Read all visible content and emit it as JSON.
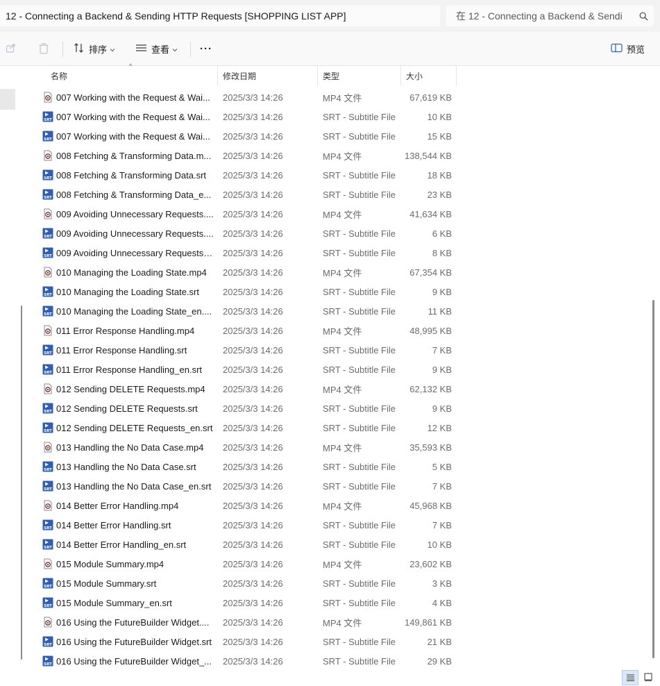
{
  "address": {
    "path": "12 - Connecting a Backend & Sending HTTP Requests  [SHOPPING LIST APP]"
  },
  "search": {
    "placeholder": "在 12 - Connecting a Backend & Sendi"
  },
  "toolbar": {
    "sort_label": "排序",
    "view_label": "查看",
    "more_label": "···",
    "preview_label": "预览"
  },
  "columns": {
    "name": "名称",
    "date": "修改日期",
    "type": "类型",
    "size": "大小"
  },
  "colors": {
    "mp4_icon_border": "#7a7a7a",
    "srt_icon_blue": "#2f5fb3",
    "secondary_text": "#6b6b6b"
  },
  "files": [
    {
      "name": "007 Working with the Request & Wai...",
      "date": "2025/3/3 14:26",
      "type": "MP4 文件",
      "size": "67,619 KB",
      "kind": "mp4"
    },
    {
      "name": "007 Working with the Request & Wai...",
      "date": "2025/3/3 14:26",
      "type": "SRT - Subtitle File",
      "size": "10 KB",
      "kind": "srt"
    },
    {
      "name": "007 Working with the Request & Wai...",
      "date": "2025/3/3 14:26",
      "type": "SRT - Subtitle File",
      "size": "15 KB",
      "kind": "srt"
    },
    {
      "name": "008 Fetching & Transforming Data.m...",
      "date": "2025/3/3 14:26",
      "type": "MP4 文件",
      "size": "138,544 KB",
      "kind": "mp4"
    },
    {
      "name": "008 Fetching & Transforming Data.srt",
      "date": "2025/3/3 14:26",
      "type": "SRT - Subtitle File",
      "size": "18 KB",
      "kind": "srt"
    },
    {
      "name": "008 Fetching & Transforming Data_e...",
      "date": "2025/3/3 14:26",
      "type": "SRT - Subtitle File",
      "size": "23 KB",
      "kind": "srt"
    },
    {
      "name": "009 Avoiding Unnecessary Requests....",
      "date": "2025/3/3 14:26",
      "type": "MP4 文件",
      "size": "41,634 KB",
      "kind": "mp4"
    },
    {
      "name": "009 Avoiding Unnecessary Requests....",
      "date": "2025/3/3 14:26",
      "type": "SRT - Subtitle File",
      "size": "6 KB",
      "kind": "srt"
    },
    {
      "name": "009 Avoiding Unnecessary Requests_...",
      "date": "2025/3/3 14:26",
      "type": "SRT - Subtitle File",
      "size": "8 KB",
      "kind": "srt"
    },
    {
      "name": "010 Managing the Loading State.mp4",
      "date": "2025/3/3 14:26",
      "type": "MP4 文件",
      "size": "67,354 KB",
      "kind": "mp4"
    },
    {
      "name": "010 Managing the Loading State.srt",
      "date": "2025/3/3 14:26",
      "type": "SRT - Subtitle File",
      "size": "9 KB",
      "kind": "srt"
    },
    {
      "name": "010 Managing the Loading State_en....",
      "date": "2025/3/3 14:26",
      "type": "SRT - Subtitle File",
      "size": "11 KB",
      "kind": "srt"
    },
    {
      "name": "011 Error Response Handling.mp4",
      "date": "2025/3/3 14:26",
      "type": "MP4 文件",
      "size": "48,995 KB",
      "kind": "mp4"
    },
    {
      "name": "011 Error Response Handling.srt",
      "date": "2025/3/3 14:26",
      "type": "SRT - Subtitle File",
      "size": "7 KB",
      "kind": "srt"
    },
    {
      "name": "011 Error Response Handling_en.srt",
      "date": "2025/3/3 14:26",
      "type": "SRT - Subtitle File",
      "size": "9 KB",
      "kind": "srt"
    },
    {
      "name": "012 Sending DELETE Requests.mp4",
      "date": "2025/3/3 14:26",
      "type": "MP4 文件",
      "size": "62,132 KB",
      "kind": "mp4"
    },
    {
      "name": "012 Sending DELETE Requests.srt",
      "date": "2025/3/3 14:26",
      "type": "SRT - Subtitle File",
      "size": "9 KB",
      "kind": "srt"
    },
    {
      "name": "012 Sending DELETE Requests_en.srt",
      "date": "2025/3/3 14:26",
      "type": "SRT - Subtitle File",
      "size": "12 KB",
      "kind": "srt"
    },
    {
      "name": "013 Handling the No Data Case.mp4",
      "date": "2025/3/3 14:26",
      "type": "MP4 文件",
      "size": "35,593 KB",
      "kind": "mp4"
    },
    {
      "name": "013 Handling the No Data Case.srt",
      "date": "2025/3/3 14:26",
      "type": "SRT - Subtitle File",
      "size": "5 KB",
      "kind": "srt"
    },
    {
      "name": "013 Handling the No Data Case_en.srt",
      "date": "2025/3/3 14:26",
      "type": "SRT - Subtitle File",
      "size": "7 KB",
      "kind": "srt"
    },
    {
      "name": "014 Better Error Handling.mp4",
      "date": "2025/3/3 14:26",
      "type": "MP4 文件",
      "size": "45,968 KB",
      "kind": "mp4"
    },
    {
      "name": "014 Better Error Handling.srt",
      "date": "2025/3/3 14:26",
      "type": "SRT - Subtitle File",
      "size": "7 KB",
      "kind": "srt"
    },
    {
      "name": "014 Better Error Handling_en.srt",
      "date": "2025/3/3 14:26",
      "type": "SRT - Subtitle File",
      "size": "10 KB",
      "kind": "srt"
    },
    {
      "name": "015 Module Summary.mp4",
      "date": "2025/3/3 14:26",
      "type": "MP4 文件",
      "size": "23,602 KB",
      "kind": "mp4"
    },
    {
      "name": "015 Module Summary.srt",
      "date": "2025/3/3 14:26",
      "type": "SRT - Subtitle File",
      "size": "3 KB",
      "kind": "srt"
    },
    {
      "name": "015 Module Summary_en.srt",
      "date": "2025/3/3 14:26",
      "type": "SRT - Subtitle File",
      "size": "4 KB",
      "kind": "srt"
    },
    {
      "name": "016 Using the FutureBuilder Widget....",
      "date": "2025/3/3 14:26",
      "type": "MP4 文件",
      "size": "149,861 KB",
      "kind": "mp4"
    },
    {
      "name": "016 Using the FutureBuilder Widget.srt",
      "date": "2025/3/3 14:26",
      "type": "SRT - Subtitle File",
      "size": "21 KB",
      "kind": "srt"
    },
    {
      "name": "016 Using the FutureBuilder Widget_...",
      "date": "2025/3/3 14:26",
      "type": "SRT - Subtitle File",
      "size": "29 KB",
      "kind": "srt"
    }
  ]
}
